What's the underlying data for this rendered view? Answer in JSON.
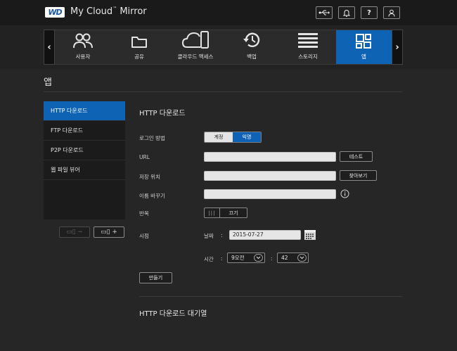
{
  "header": {
    "logo_text": "WD",
    "brand": "My Cloud",
    "brand_tm": "™",
    "brand_suffix": " Mirror",
    "buttons": [
      "usb-icon",
      "bell-icon",
      "help-icon",
      "user-icon"
    ],
    "help_label": "?"
  },
  "nav": {
    "left_arrow": "‹",
    "right_arrow": "›",
    "items": [
      {
        "label": "사용자",
        "icon": "users-icon"
      },
      {
        "label": "공유",
        "icon": "folder-icon"
      },
      {
        "label": "클라우드 액세스",
        "icon": "cloud-device-icon"
      },
      {
        "label": "백업",
        "icon": "history-icon"
      },
      {
        "label": "스토리지",
        "icon": "storage-icon"
      },
      {
        "label": "앱",
        "icon": "apps-icon"
      }
    ],
    "active": "앱"
  },
  "page": {
    "title": "앱"
  },
  "sidebar": {
    "items": [
      {
        "label": "HTTP 다운로드"
      },
      {
        "label": "FTP 다운로드"
      },
      {
        "label": "P2P 다운로드"
      },
      {
        "label": "웹 파일 뷰어"
      }
    ],
    "active": "HTTP 다운로드",
    "remove_button": "▭▯ −",
    "add_button": "▭▯ +"
  },
  "form": {
    "title": "HTTP 다운로드",
    "login_label": "로그인 방법",
    "login_options": [
      "계정",
      "익명"
    ],
    "login_selected": "익명",
    "url_label": "URL",
    "url_value": "",
    "test_button": "테스트",
    "save_label": "저장 위치",
    "save_value": "",
    "browse_button": "찾아보기",
    "rename_label": "이름 바꾸기",
    "rename_value": "",
    "repeat_label": "반복",
    "repeat_knob": "|||",
    "repeat_state": "끄기",
    "time_label": "시점",
    "date_label": "날짜",
    "colon": ":",
    "date_value": "2015-07-27",
    "hour_label": "시간",
    "hour_value": "9오전",
    "minute_value": "42",
    "create_button": "만들기",
    "queue_title": "HTTP 다운로드 대기열"
  },
  "colors": {
    "accent": "#0e63b5",
    "background": "#262626",
    "topbar": "#1a1a1a"
  }
}
